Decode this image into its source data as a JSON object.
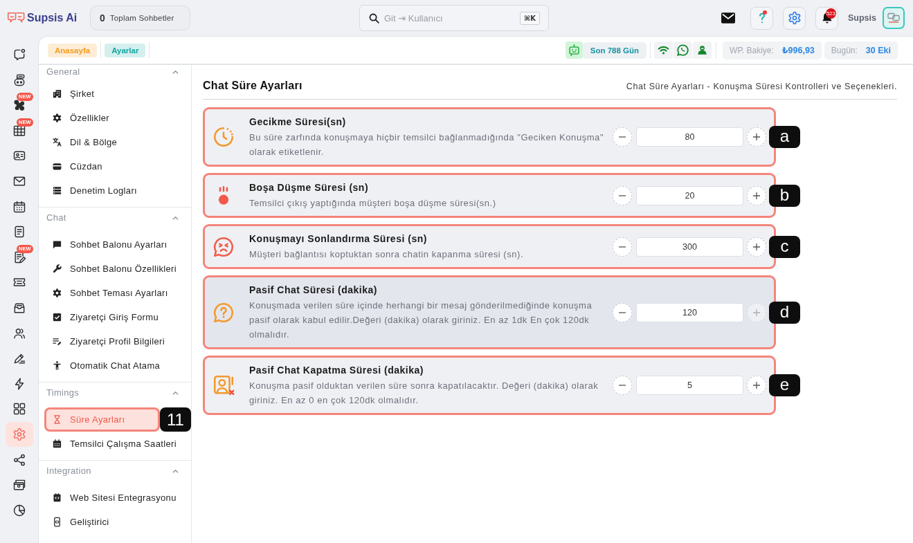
{
  "header": {
    "logo": "Supsis Ai",
    "chat_count": {
      "value": "0",
      "label": "Toplam Sohbetler"
    },
    "search": {
      "placeholder": "Git ⇥ Kullanıcı",
      "shortcut": "⌘K"
    },
    "help": {
      "unread": true
    },
    "notifications": {
      "count": "523"
    },
    "user": {
      "name": "Supsis"
    }
  },
  "rail": [
    {
      "selected": false
    },
    {
      "selected": false
    },
    {
      "selected": false,
      "badge": "NEW"
    },
    {
      "selected": false,
      "badge": "NEW"
    },
    {
      "selected": false
    },
    {
      "selected": false
    },
    {
      "selected": false
    },
    {
      "selected": false
    },
    {
      "selected": false,
      "badge": "NEW"
    },
    {
      "selected": false
    },
    {
      "selected": false
    },
    {
      "selected": false
    },
    {
      "selected": false
    },
    {
      "selected": false
    },
    {
      "selected": false
    },
    {
      "selected": true
    },
    {
      "selected": false
    },
    {
      "selected": false
    },
    {
      "selected": false
    }
  ],
  "breadcrumbs": [
    {
      "label": "Anasayfa",
      "color": "#f39c1e"
    },
    {
      "label": "Ayarlar",
      "color": "#12a59e"
    }
  ],
  "status": {
    "plan": "Son 788 Gün",
    "balance": {
      "label": "WP. Bakiye:",
      "value": "₺996,93"
    },
    "today": {
      "label": "Bugün:",
      "value": "30 Eki"
    }
  },
  "sidebar": [
    {
      "title": "General",
      "expanded": true,
      "items": [
        {
          "label": "Şirket",
          "selected": false
        },
        {
          "label": "Özellikler",
          "selected": false
        },
        {
          "label": "Dil & Bölge",
          "selected": false
        },
        {
          "label": "Cüzdan",
          "selected": false
        },
        {
          "label": "Denetim Logları",
          "selected": false
        }
      ]
    },
    {
      "title": "Chat",
      "expanded": true,
      "items": [
        {
          "label": "Sohbet Balonu Ayarları",
          "selected": false
        },
        {
          "label": "Sohbet Balonu Özellikleri",
          "selected": false
        },
        {
          "label": "Sohbet Teması Ayarları",
          "selected": false
        },
        {
          "label": "Ziyaretçi Giriş Formu",
          "selected": false
        },
        {
          "label": "Ziyaretçi Profil Bilgileri",
          "selected": false
        },
        {
          "label": "Otomatik Chat Atama",
          "selected": false
        }
      ]
    },
    {
      "title": "Timings",
      "expanded": true,
      "items": [
        {
          "label": "Süre Ayarları",
          "selected": true,
          "callout": "11"
        },
        {
          "label": "Temsilci Çalışma Saatleri",
          "selected": false
        }
      ]
    },
    {
      "title": "Integration",
      "expanded": true,
      "items": [
        {
          "label": "Web Sitesi Entegrasyonu",
          "selected": false
        },
        {
          "label": "Geliştirici",
          "selected": false
        }
      ]
    }
  ],
  "page": {
    "title": "Chat Süre Ayarları",
    "subtitle": "Chat Süre Ayarları - Konuşma Süresi Kontrolleri ve Seçenekleri."
  },
  "settings": [
    {
      "title": "Gecikme Süresi(sn)",
      "description": "Bu süre zarfında konuşmaya hiçbir temsilci bağlanmadığında \"Geciken Konuşma\" olarak etiketlenir.",
      "value": "80",
      "plus_disabled": false,
      "hovered": false,
      "callout": "a"
    },
    {
      "title": "Boşa Düşme Süresi (sn)",
      "description": "Temsilci çıkış yaptığında müşteri boşa düşme süresi(sn.)",
      "value": "20",
      "plus_disabled": false,
      "hovered": false,
      "callout": "b"
    },
    {
      "title": "Konuşmayı Sonlandırma Süresi (sn)",
      "description": "Müşteri bağlantısı koptuktan sonra chatin kapanma süresi (sn).",
      "value": "300",
      "plus_disabled": false,
      "hovered": false,
      "callout": "c"
    },
    {
      "title": "Pasif Chat Süresi (dakika)",
      "description": "Konuşmada verilen süre içinde herhangi bir mesaj gönderilmediğinde konuşma pasif olarak kabul edilir.Değeri (dakika) olarak giriniz. En az 1dk En çok 120dk olmalıdır.",
      "value": "120",
      "plus_disabled": true,
      "hovered": true,
      "callout": "d"
    },
    {
      "title": "Pasif Chat Kapatma Süresi (dakika)",
      "description": "Konuşma pasif olduktan verilen süre sonra kapatılacaktır. Değeri (dakika) olarak giriniz. En az 0 en çok 120dk olmalıdır.",
      "value": "5",
      "plus_disabled": false,
      "hovered": false,
      "callout": "e"
    }
  ]
}
